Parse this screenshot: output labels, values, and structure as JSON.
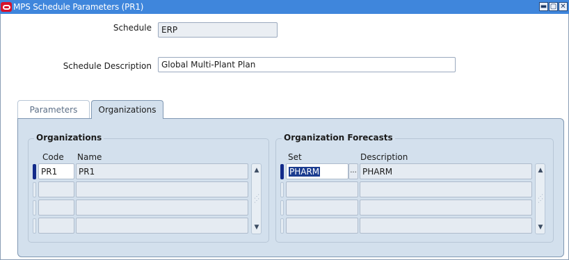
{
  "window": {
    "title": "MPS Schedule Parameters (PR1)",
    "app_icon": "oracle-icon",
    "buttons": [
      "minimize-icon",
      "maximize-icon",
      "close-icon"
    ]
  },
  "form": {
    "schedule_label": "Schedule",
    "schedule_value": "ERP",
    "description_label": "Schedule Description",
    "description_value": "Global Multi-Plant Plan"
  },
  "tabs": [
    {
      "label": "Parameters",
      "active": false
    },
    {
      "label": "Organizations",
      "active": true
    }
  ],
  "organizations": {
    "title": "Organizations",
    "headers": {
      "code": "Code",
      "name": "Name"
    },
    "rows": [
      {
        "code": "PR1",
        "name": "PR1"
      },
      {
        "code": "",
        "name": ""
      },
      {
        "code": "",
        "name": ""
      },
      {
        "code": "",
        "name": ""
      }
    ]
  },
  "forecasts": {
    "title": "Organization Forecasts",
    "headers": {
      "set": "Set",
      "description": "Description"
    },
    "lov_button": "...",
    "rows": [
      {
        "set": "PHARM",
        "description": "PHARM"
      },
      {
        "set": "",
        "description": ""
      },
      {
        "set": "",
        "description": ""
      },
      {
        "set": "",
        "description": ""
      }
    ]
  },
  "colors": {
    "titlebar": "#3f86dc",
    "panel": "#d3e0ed",
    "current_record": "#122a8a",
    "selection": "#1b3c8f"
  }
}
